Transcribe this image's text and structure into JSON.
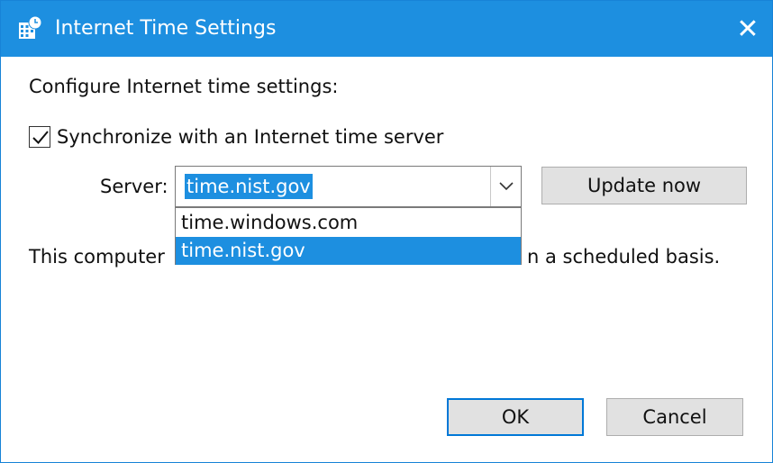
{
  "window": {
    "title": "Internet Time Settings",
    "close_glyph": "✕",
    "accent_color": "#1d8fe0"
  },
  "content": {
    "heading": "Configure Internet time settings:",
    "sync_checkbox": {
      "label": "Synchronize with an Internet time server",
      "checked": true
    },
    "server": {
      "label": "Server:",
      "value": "time.nist.gov",
      "options": [
        "time.windows.com",
        "time.nist.gov"
      ],
      "selected_index": 1
    },
    "update_button": "Update now",
    "info_text_left": "This computer",
    "info_text_right": "n a scheduled basis."
  },
  "footer": {
    "ok_label": "OK",
    "cancel_label": "Cancel"
  }
}
